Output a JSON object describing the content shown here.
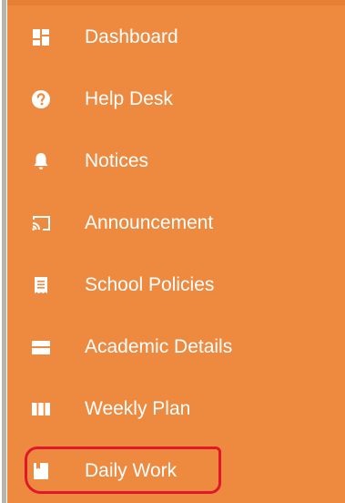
{
  "sidebar": {
    "items": [
      {
        "label": "Dashboard",
        "icon": "dashboard-icon"
      },
      {
        "label": "Help Desk",
        "icon": "question-circle-icon"
      },
      {
        "label": "Notices",
        "icon": "bell-icon"
      },
      {
        "label": "Announcement",
        "icon": "cast-icon"
      },
      {
        "label": "School Policies",
        "icon": "document-list-icon"
      },
      {
        "label": "Academic Details",
        "icon": "id-card-icon"
      },
      {
        "label": "Weekly Plan",
        "icon": "columns-icon"
      },
      {
        "label": "Daily Work",
        "icon": "bookmark-book-icon"
      }
    ],
    "colors": {
      "background": "#ee8a40",
      "text": "#ffffff",
      "highlight": "#e0182a"
    }
  }
}
